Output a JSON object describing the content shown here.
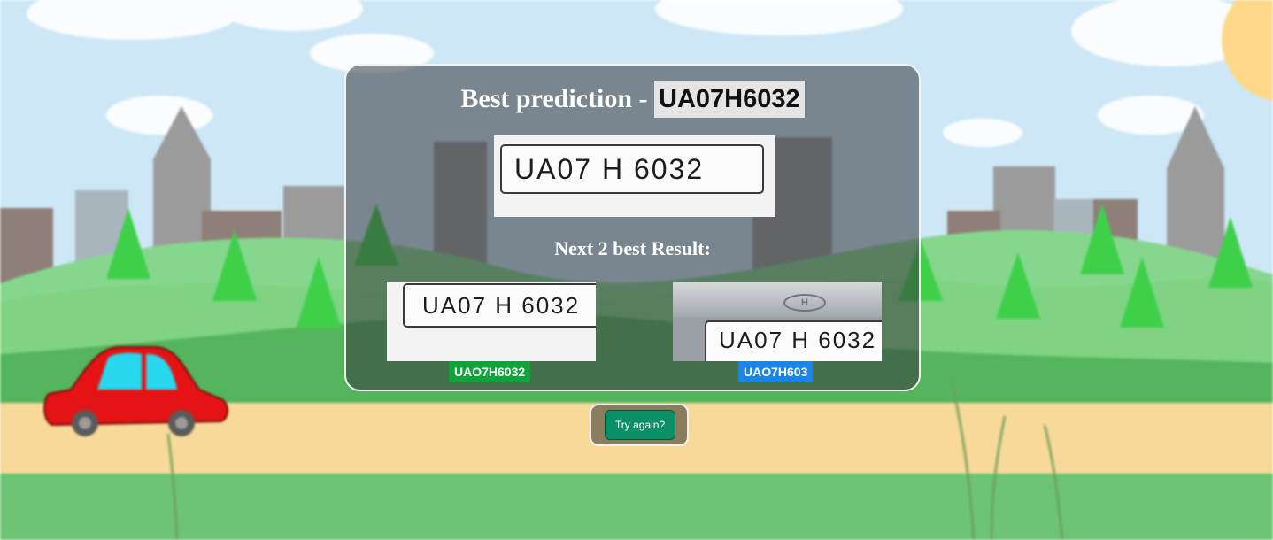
{
  "result": {
    "title_prefix": "Best prediction -",
    "best_plate": "UA07H6032",
    "best_image_text": "UA07 H 6032",
    "next_title": "Next 2 best Result:",
    "alternatives": [
      {
        "image_text": "UA07 H 6032",
        "label": "UAO7H6032",
        "color": "#0fa33a"
      },
      {
        "image_text": "UA07 H 6032",
        "label": "UAO7H603",
        "color": "#1a84e8"
      }
    ]
  },
  "actions": {
    "try_again_label": "Try again?"
  },
  "colors": {
    "sky": "#cce6f7",
    "hills": "#86d78e",
    "road": "#f7d999",
    "car": "#e41414",
    "button": "#0a8f66"
  }
}
